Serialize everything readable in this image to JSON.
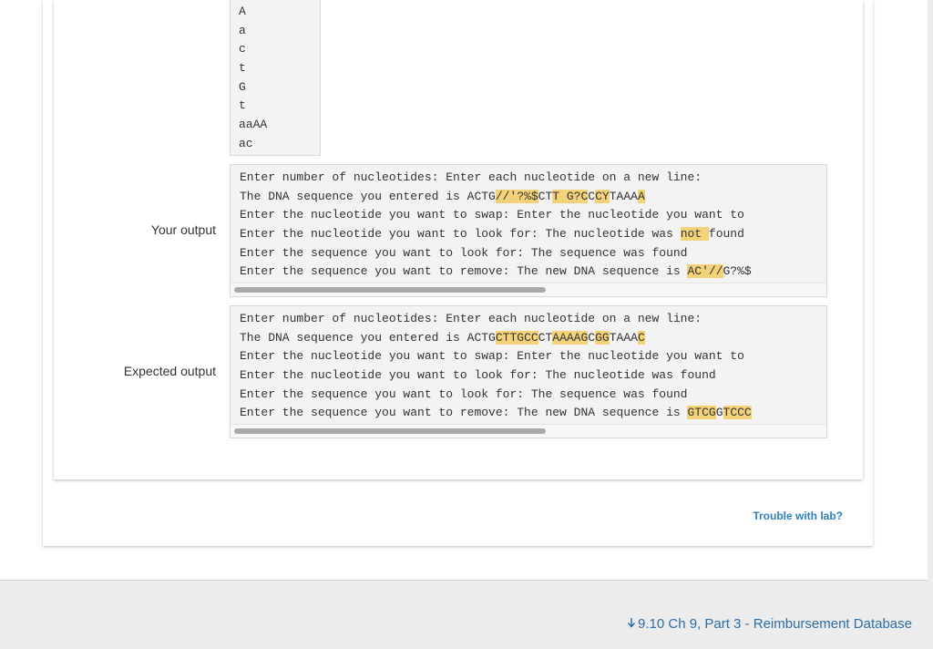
{
  "input_lines": [
    "A",
    "a",
    "c",
    "t",
    "G",
    "t",
    "aaAA",
    "ac"
  ],
  "your_output": {
    "label": "Your output",
    "lines": [
      [
        {
          "t": "Enter number of nucleotides: Enter each nucleotide on a new line:"
        }
      ],
      [
        {
          "t": "The DNA sequence you entered is ACTG"
        },
        {
          "t": "//'?%$",
          "h": true
        },
        {
          "t": "CT"
        },
        {
          "t": "T G?C",
          "h": true
        },
        {
          "t": "C"
        },
        {
          "t": "CY",
          "h": true
        },
        {
          "t": "TAAA"
        },
        {
          "t": "A",
          "h": true
        }
      ],
      [
        {
          "t": "Enter the nucleotide you want to swap: Enter the nucleotide you want to"
        }
      ],
      [
        {
          "t": "Enter the nucleotide you want to look for: The nucleotide was "
        },
        {
          "t": "not ",
          "h": true
        },
        {
          "t": "found"
        }
      ],
      [
        {
          "t": "Enter the sequence you want to look for: The sequence was found"
        }
      ],
      [
        {
          "t": "Enter the sequence you want to remove: The new DNA sequence is "
        },
        {
          "t": "AC'//",
          "h": true
        },
        {
          "t": "G?%$"
        }
      ]
    ]
  },
  "expected_output": {
    "label": "Expected output",
    "lines": [
      [
        {
          "t": "Enter number of nucleotides: Enter each nucleotide on a new line:"
        }
      ],
      [
        {
          "t": "The DNA sequence you entered is ACTG"
        },
        {
          "t": "CTTGCC",
          "h": true
        },
        {
          "t": "CT"
        },
        {
          "t": "AAAAG",
          "h": true
        },
        {
          "t": "C"
        },
        {
          "t": "GG",
          "h": true
        },
        {
          "t": "TAAA"
        },
        {
          "t": "C",
          "h": true
        }
      ],
      [
        {
          "t": "Enter the nucleotide you want to swap: Enter the nucleotide you want to"
        }
      ],
      [
        {
          "t": "Enter the nucleotide you want to look for: The nucleotide was found"
        }
      ],
      [
        {
          "t": "Enter the sequence you want to look for: The sequence was found"
        }
      ],
      [
        {
          "t": "Enter the sequence you want to remove: The new DNA sequence is "
        },
        {
          "t": "GTCG",
          "h": true
        },
        {
          "t": "G"
        },
        {
          "t": "TCCC",
          "h": true
        }
      ]
    ]
  },
  "links": {
    "trouble": "Trouble with lab?",
    "next": "9.10 Ch 9, Part 3 - Reimbursement Database"
  },
  "colors": {
    "highlight": "#f3d27a",
    "link": "#2d7fb8"
  },
  "icons": {
    "next_arrow": "arrow-down-icon"
  }
}
